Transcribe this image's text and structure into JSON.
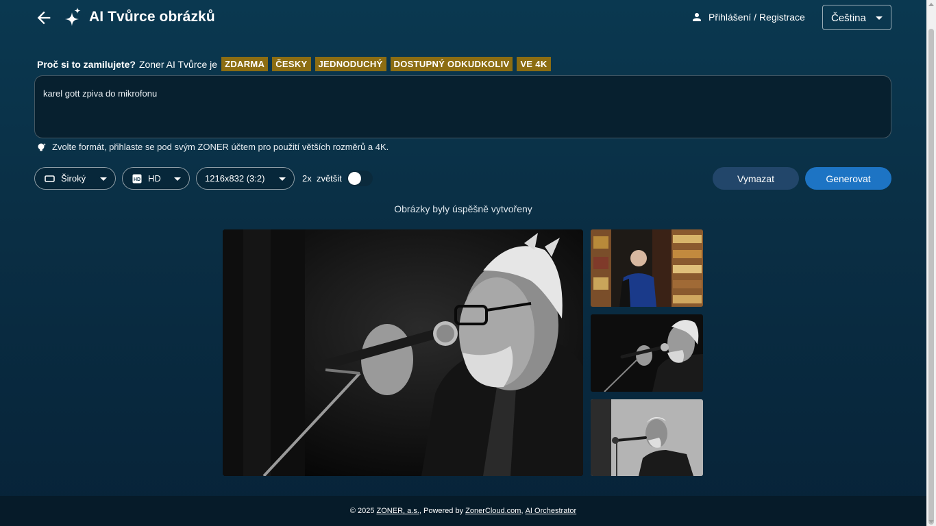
{
  "header": {
    "title": "AI Tvůrce obrázků",
    "login_label": "Přihlášení / Registrace",
    "language": "Čeština"
  },
  "features": {
    "question": "Proč si to zamilujete?",
    "intro": "Zoner AI Tvůrce je",
    "badges": [
      "ZDARMA",
      "ČESKY",
      "JEDNODUCHÝ",
      "DOSTUPNÝ ODKUDKOLIV",
      "VE 4K"
    ],
    "badge_color": "#8c6d12"
  },
  "prompt": {
    "value": "karel gott zpiva do mikrofonu"
  },
  "hint": "Zvolte formát, přihlaste se pod svým ZONER účtem pro použití větších rozměrů a 4K.",
  "controls": {
    "format": "Široký",
    "quality": "HD",
    "size": "1216x832 (3:2)",
    "upscale_label": "2x  zvětšit",
    "upscale_on": false,
    "clear_label": "Vymazat",
    "generate_label": "Generovat",
    "accent": "#1d74c4"
  },
  "status": "Obrázky byly úspěšně vytvořeny",
  "footer": {
    "copyright": "© 2025 ",
    "company": "ZONER, a.s.",
    "powered": ", Powered by ",
    "cloud": "ZonerCloud.com",
    "comma": ", ",
    "orchestrator": "AI Orchestrator"
  }
}
